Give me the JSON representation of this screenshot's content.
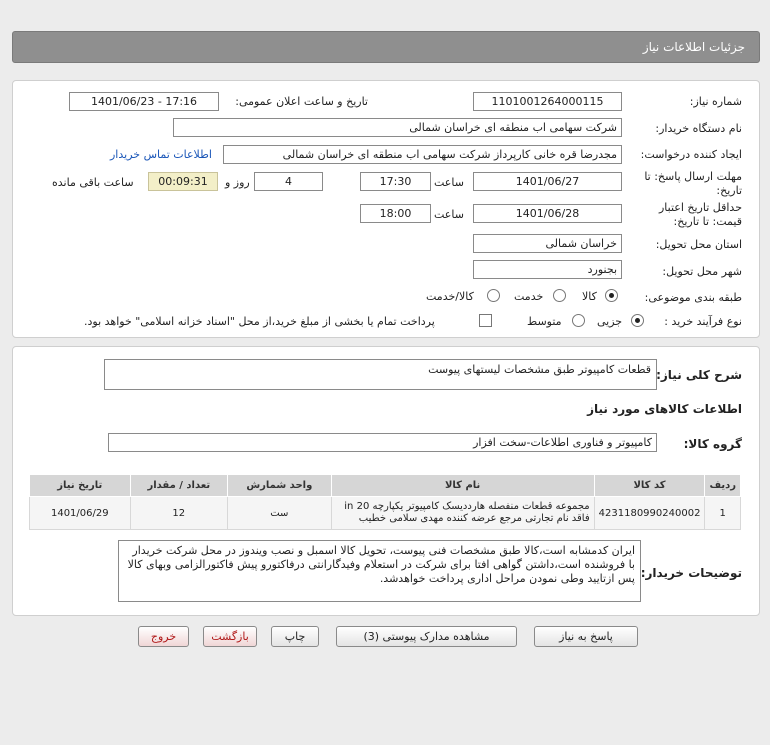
{
  "header": {
    "title": "جزئيات اطلاعات نياز"
  },
  "labels": {
    "need_number": "شماره نياز:",
    "announce_datetime": "تاريخ و ساعت اعلان عمومی:",
    "buyer_org": "نام دستگاه خريدار:",
    "requester": "ايجاد کننده درخواست:",
    "contact_link": "اطلاعات تماس خريدار",
    "send_deadline": "مهلت ارسال پاسخ: تا تاريخ:",
    "hour": "ساعت",
    "days_and": "روز و",
    "remaining": "ساعت باقی مانده",
    "validity": "حداقل تاريخ اعتبار قيمت: تا تاريخ:",
    "delivery_province": "استان محل تحويل:",
    "delivery_city": "شهر محل تحويل:",
    "category": "طبقه بندی موضوعی:",
    "purchase_type": "نوع فرآيند خريد :",
    "payment_note": "پرداخت تمام يا بخشی از مبلغ خريد،از محل \"اسناد خزانه اسلامی\" خواهد بود."
  },
  "values": {
    "need_number": "1101001264000115",
    "announce_datetime": "1401/06/23 - 17:16",
    "buyer_org": "شرکت سهامی اب منطقه ای خراسان شمالی",
    "requester": "مجدرضا قره خانی کارپرداز شرکت سهامی اب منطقه ای خراسان شمالی",
    "send_date": "1401/06/27",
    "send_time": "17:30",
    "days": "4",
    "remaining_time": "00:09:31",
    "validity_date": "1401/06/28",
    "validity_time": "18:00",
    "province": "خراسان شمالی",
    "city": "بجنورد"
  },
  "category_options": {
    "goods": "کالا",
    "service": "خدمت",
    "goods_service": "کالا/خدمت"
  },
  "purchase_options": {
    "minor": "جزيی",
    "medium": "متوسط"
  },
  "summary": {
    "label": "شرح کلی نياز:",
    "value": "قطعات کامپيوتر طبق مشخصات ليستهای  پيوست"
  },
  "goods_info_title": "اطلاعات کالاهای مورد نياز",
  "goods_group": {
    "label": "گروه کالا:",
    "value": "کامپيوتر و فناوری اطلاعات-سخت افزار"
  },
  "table": {
    "headers": [
      "رديف",
      "کد کالا",
      "نام کالا",
      "واحد شمارش",
      "تعداد / مقدار",
      "تاريخ نياز"
    ],
    "rows": [
      {
        "index": "1",
        "code": "4231180990240002",
        "name": "مجموعه قطعات منفصله هارددیسک کامپیوتر یکپارچه in 20 فاقد نام تجارتی مرجع عرضه کننده مهدی سلامی خطیب",
        "unit": "ست",
        "qty": "12",
        "date": "1401/06/29"
      }
    ]
  },
  "buyer_notes": {
    "label": "توضيحات خريدار:",
    "value": "ايران کدمشابه است،کالا طبق مشخصات فنی پيوست، تحويل کالا اسمبل و نصب ويندوز در محل شرکت خريدار با فروشنده است،داشتن گواهی افتا برای شرکت در استعلام وفيدگارانتی درفاکتورو پيش فاکتورالزامی وبهای کالا پس ازتاييد وطی نمودن مراحل اداری پرداخت خواهدشد."
  },
  "buttons": {
    "reply": "پاسخ به نياز",
    "view_docs": "مشاهده مدارک پيوستی (3)",
    "print": "چاپ",
    "back": "بازگشت",
    "exit": "خروج"
  }
}
